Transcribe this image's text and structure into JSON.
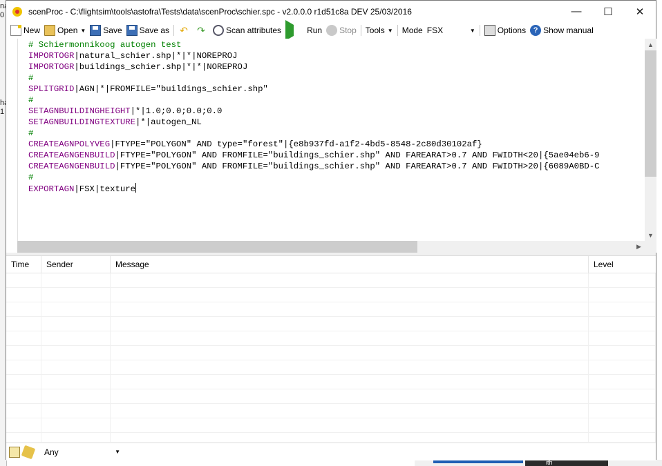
{
  "window": {
    "title": "scenProc - C:\\flightsim\\tools\\astofra\\Tests\\data\\scenProc\\schier.spc - v2.0.0.0 r1d51c8a DEV 25/03/2016",
    "minimize": "—",
    "maximize": "☐",
    "close": "✕"
  },
  "toolbar": {
    "new": "New",
    "open": "Open",
    "save": "Save",
    "save_as": "Save as",
    "scan_attributes": "Scan attributes",
    "run": "Run",
    "stop": "Stop",
    "tools": "Tools",
    "mode_label": "Mode",
    "mode_value": "FSX",
    "options": "Options",
    "show_manual": "Show manual"
  },
  "editor": {
    "lines": [
      {
        "kind": "comment",
        "text": "# Schiermonnikoog autogen test"
      },
      {
        "kind": "cmd",
        "cmd": "IMPORTOGR",
        "rest": "|natural_schier.shp|*|*|NOREPROJ"
      },
      {
        "kind": "cmd",
        "cmd": "IMPORTOGR",
        "rest": "|buildings_schier.shp|*|*|NOREPROJ"
      },
      {
        "kind": "comment",
        "text": "#"
      },
      {
        "kind": "cmd",
        "cmd": "SPLITGRID",
        "rest": "|AGN|*|FROMFILE=\"buildings_schier.shp\""
      },
      {
        "kind": "comment",
        "text": "#"
      },
      {
        "kind": "cmd",
        "cmd": "SETAGNBUILDINGHEIGHT",
        "rest": "|*|1.0;0.0;0.0;0.0"
      },
      {
        "kind": "cmd",
        "cmd": "SETAGNBUILDINGTEXTURE",
        "rest": "|*|autogen_NL"
      },
      {
        "kind": "comment",
        "text": "#"
      },
      {
        "kind": "cmd",
        "cmd": "CREATEAGNPOLYVEG",
        "rest": "|FTYPE=\"POLYGON\" AND type=\"forest\"|{e8b937fd-a1f2-4bd5-8548-2c80d30102af}"
      },
      {
        "kind": "cmd",
        "cmd": "CREATEAGNGENBUILD",
        "rest": "|FTYPE=\"POLYGON\" AND FROMFILE=\"buildings_schier.shp\" AND FAREARAT>0.7 AND FWIDTH<20|{5ae04eb6-9"
      },
      {
        "kind": "cmd",
        "cmd": "CREATEAGNGENBUILD",
        "rest": "|FTYPE=\"POLYGON\" AND FROMFILE=\"buildings_schier.shp\" AND FAREARAT>0.7 AND FWIDTH>20|{6089A0BD-C"
      },
      {
        "kind": "comment",
        "text": "#"
      },
      {
        "kind": "cmd",
        "cmd": "EXPORTAGN",
        "rest": "|FSX|texture",
        "caret": true
      }
    ]
  },
  "log": {
    "columns": {
      "time": "Time",
      "sender": "Sender",
      "message": "Message",
      "level": "Level"
    },
    "row_count": 12
  },
  "status": {
    "level_filter": "Any"
  },
  "desktop": {
    "left_fragments": [
      "na",
      "0",
      "ha",
      "1"
    ],
    "taskbar_fragment": "ith"
  },
  "colors": {
    "comment": "#008000",
    "keyword": "#800080",
    "run_green": "#2e9b2e",
    "help_blue": "#2a64b8"
  }
}
